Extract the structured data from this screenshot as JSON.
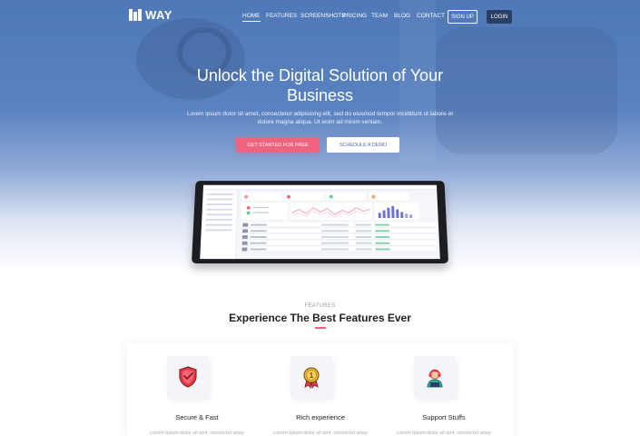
{
  "logo": {
    "text": "WAY",
    "icon": "bars-logo-icon"
  },
  "nav": {
    "items": [
      {
        "label": "HOME",
        "active": true
      },
      {
        "label": "FEATURES",
        "active": false
      },
      {
        "label": "SCREENSHOTS",
        "active": false
      },
      {
        "label": "PRICING",
        "active": false
      },
      {
        "label": "TEAM",
        "active": false
      },
      {
        "label": "BLOG",
        "active": false
      },
      {
        "label": "CONTACT",
        "active": false
      }
    ],
    "signup_label": "SIGN UP",
    "login_label": "LOGIN"
  },
  "hero": {
    "title_line1": "Unlock the Digital Solution of Your",
    "title_line2": "Business",
    "description": "Lorem ipsum dolor sit amet, consectetur adipisicing elit, sed do eiusmod tempor incididunt ut labore et dolore magna aliqua. Ut enim ad minim veniam.",
    "cta_primary": "GET STARTED FOR FREE",
    "cta_secondary": "SCHEDULE A DEMO"
  },
  "features": {
    "label": "FEATURES",
    "title": "Experience The Best Features Ever",
    "cards": [
      {
        "name": "Secure & Fast",
        "text": "Lorem ipsum dolor sit amt, consectet adop",
        "icon": "shield-check-icon"
      },
      {
        "name": "Rich experience",
        "text": "Lorem ipsum dolor sit amt, consectet adop",
        "icon": "medal-icon"
      },
      {
        "name": "Support Stuffs",
        "text": "Lorem ipsum dolor sit amt, consectet adop",
        "icon": "support-agent-icon"
      }
    ]
  },
  "colors": {
    "hero_blue": "#4f78b8",
    "accent_pink": "#f0637f",
    "login_navy": "#2a3f68"
  }
}
